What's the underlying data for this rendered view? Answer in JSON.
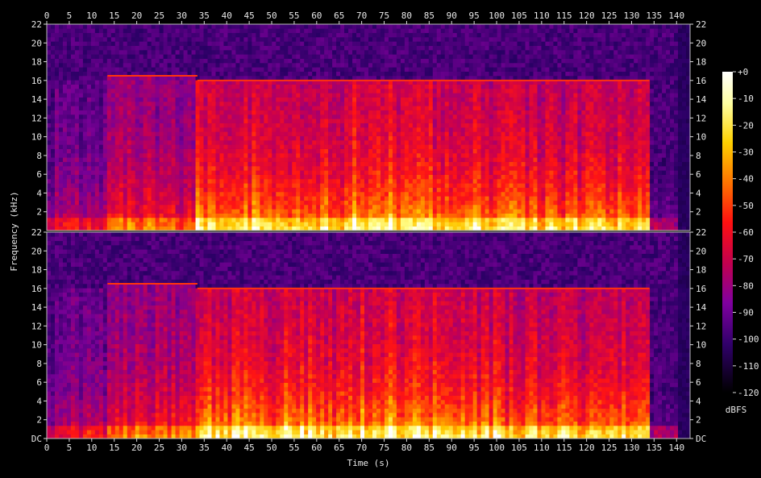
{
  "chart_data": {
    "type": "heatmap",
    "xlabel": "Time (s)",
    "ylabel": "Frequency (kHz)",
    "xlim": [
      0,
      143
    ],
    "ylim": [
      0,
      22
    ],
    "x_ticks": [
      "0",
      "5",
      "10",
      "15",
      "20",
      "25",
      "30",
      "35",
      "40",
      "45",
      "50",
      "55",
      "60",
      "65",
      "70",
      "75",
      "80",
      "85",
      "90",
      "95",
      "100",
      "105",
      "110",
      "115",
      "120",
      "125",
      "130",
      "135",
      "140"
    ],
    "y_ticks_top": [
      "2",
      "4",
      "6",
      "8",
      "10",
      "12",
      "14",
      "16",
      "18",
      "20",
      "22"
    ],
    "y_ticks_bottom": [
      "DC",
      "2",
      "4",
      "6",
      "8",
      "10",
      "12",
      "14",
      "16",
      "18",
      "20",
      "22"
    ],
    "channels": 2,
    "colorbar": {
      "label": "dBFS",
      "ticks": [
        "+0",
        "-10",
        "-20",
        "-30",
        "-40",
        "-50",
        "-60",
        "-70",
        "-80",
        "-90",
        "-100",
        "-110",
        "-120"
      ],
      "range": [
        -120,
        0
      ]
    },
    "segments": [
      {
        "t_start": 0,
        "t_end": 1.5,
        "cutoff_khz": 16,
        "level": 0.35
      },
      {
        "t_start": 1.5,
        "t_end": 13.5,
        "cutoff_khz": 16,
        "level": 0.45
      },
      {
        "t_start": 13.5,
        "t_end": 33.5,
        "cutoff_khz": 16.5,
        "level": 0.6
      },
      {
        "t_start": 33.5,
        "t_end": 68,
        "cutoff_khz": 16,
        "level": 0.8
      },
      {
        "t_start": 68,
        "t_end": 84,
        "cutoff_khz": 16,
        "level": 0.85
      },
      {
        "t_start": 84,
        "t_end": 100,
        "cutoff_khz": 16,
        "level": 0.8
      },
      {
        "t_start": 100,
        "t_end": 134,
        "cutoff_khz": 16,
        "level": 0.75
      },
      {
        "t_start": 134,
        "t_end": 140,
        "cutoff_khz": 8,
        "level": 0.3
      }
    ]
  }
}
